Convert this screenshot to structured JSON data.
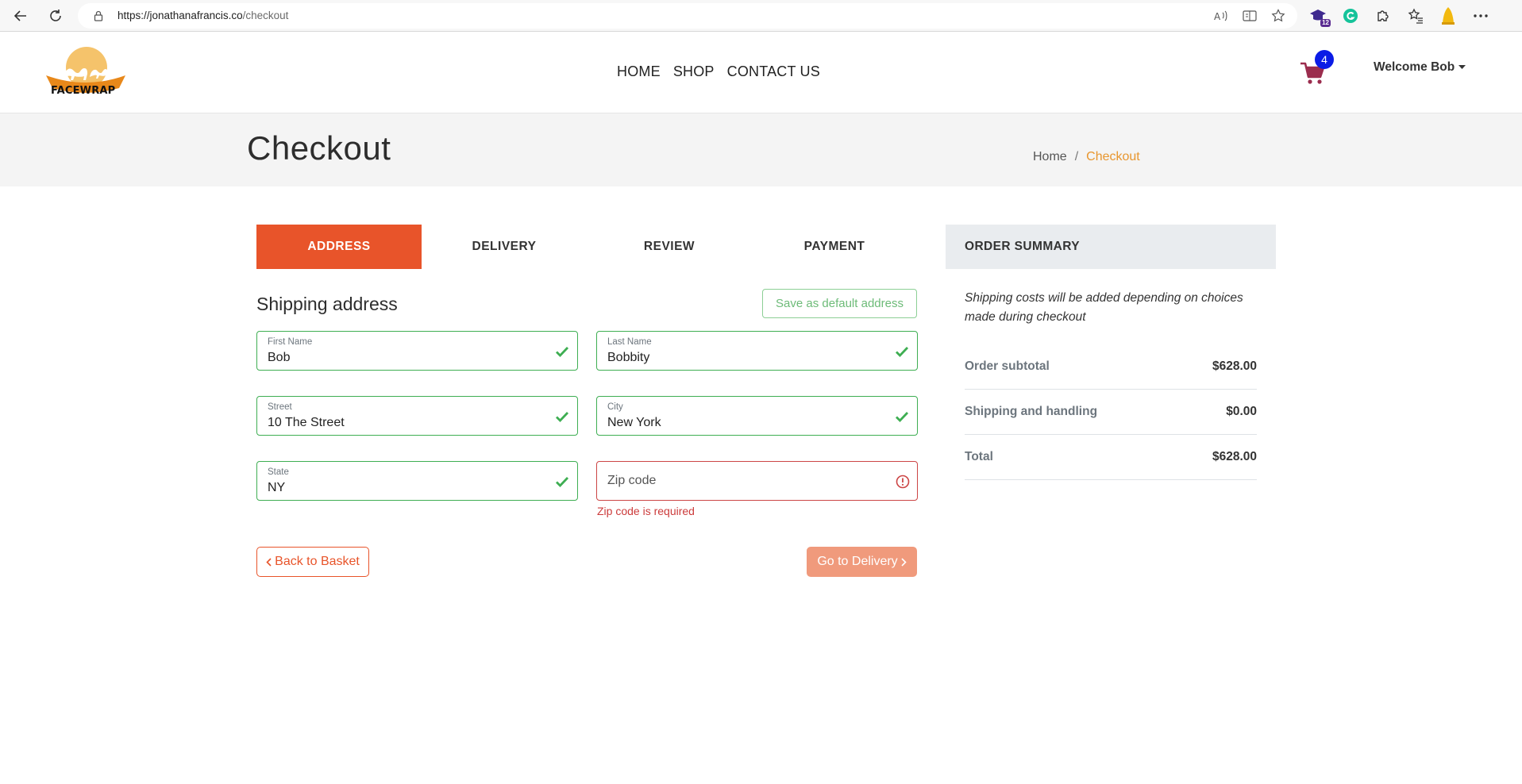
{
  "browser": {
    "url_host": "https://jonathanafrancis.co",
    "url_path": "/checkout",
    "ext_badge": "12"
  },
  "header": {
    "logo_text": "FACEWRAP",
    "nav": [
      "HOME",
      "SHOP",
      "CONTACT US"
    ],
    "cart_count": "4",
    "welcome": "Welcome Bob"
  },
  "banner": {
    "title": "Checkout",
    "breadcrumb_home": "Home",
    "breadcrumb_sep": "/",
    "breadcrumb_current": "Checkout"
  },
  "steps": [
    {
      "label": "ADDRESS",
      "active": true
    },
    {
      "label": "DELIVERY",
      "active": false
    },
    {
      "label": "REVIEW",
      "active": false
    },
    {
      "label": "PAYMENT",
      "active": false
    }
  ],
  "form": {
    "title": "Shipping address",
    "save_default_label": "Save as default address",
    "first_name": {
      "label": "First Name",
      "value": "Bob"
    },
    "last_name": {
      "label": "Last Name",
      "value": "Bobbity"
    },
    "street": {
      "label": "Street",
      "value": "10 The Street"
    },
    "city": {
      "label": "City",
      "value": "New York"
    },
    "state": {
      "label": "State",
      "value": "NY"
    },
    "zip": {
      "placeholder": "Zip code",
      "error": "Zip code is required"
    },
    "back_label": "Back to Basket",
    "next_label": "Go to Delivery"
  },
  "summary": {
    "title": "ORDER SUMMARY",
    "note": "Shipping costs will be added depending on choices made during checkout",
    "rows": [
      {
        "label": "Order subtotal",
        "amount": "$628.00"
      },
      {
        "label": "Shipping and handling",
        "amount": "$0.00"
      },
      {
        "label": "Total",
        "amount": "$628.00"
      }
    ]
  },
  "colors": {
    "accent": "#e8542a",
    "valid": "#3eae52",
    "invalid": "#cc4545",
    "breadcrumb_current": "#e8962e",
    "cart_badge": "#0b1ce6"
  }
}
